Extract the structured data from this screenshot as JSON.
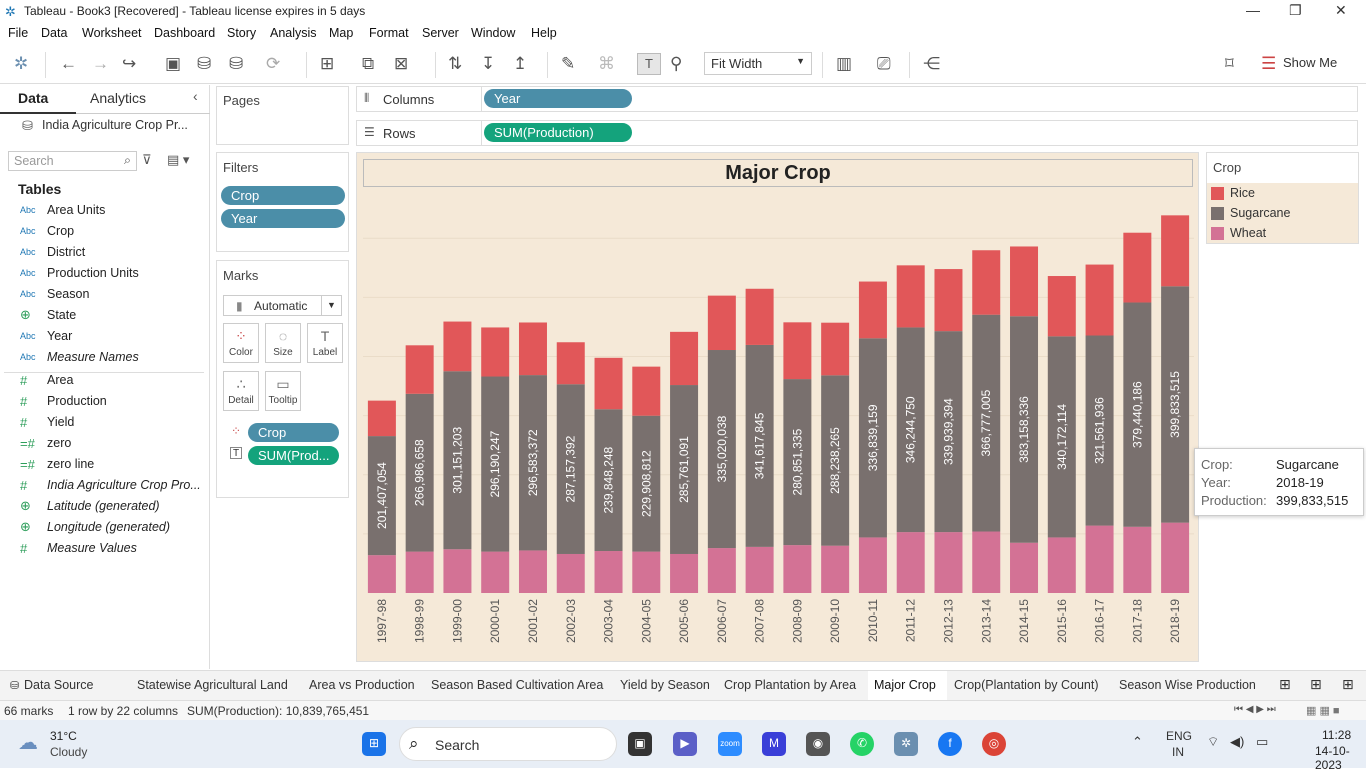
{
  "window": {
    "title": "Tableau - Book3 [Recovered] - Tableau license expires in 5 days"
  },
  "menu": [
    "File",
    "Data",
    "Worksheet",
    "Dashboard",
    "Story",
    "Analysis",
    "Map",
    "Format",
    "Server",
    "Window",
    "Help"
  ],
  "toolbar": {
    "fit": "Fit Width",
    "show_me": "Show Me"
  },
  "data_pane": {
    "tab_data": "Data",
    "tab_analytics": "Analytics",
    "datasource": "India Agriculture Crop Pr...",
    "search_placeholder": "Search",
    "tables_heading": "Tables",
    "dimensions": [
      {
        "icon": "Abc",
        "name": "Area Units"
      },
      {
        "icon": "Abc",
        "name": "Crop"
      },
      {
        "icon": "Abc",
        "name": "District"
      },
      {
        "icon": "Abc",
        "name": "Production Units"
      },
      {
        "icon": "Abc",
        "name": "Season"
      },
      {
        "icon": "globe",
        "name": "State"
      },
      {
        "icon": "Abc",
        "name": "Year"
      },
      {
        "icon": "Abc",
        "name": "Measure Names"
      }
    ],
    "measures": [
      {
        "icon": "#",
        "name": "Area"
      },
      {
        "icon": "#",
        "name": "Production"
      },
      {
        "icon": "#",
        "name": "Yield"
      },
      {
        "icon": "=#",
        "name": "zero"
      },
      {
        "icon": "=#",
        "name": "zero line"
      },
      {
        "icon": "#",
        "name": "India Agriculture Crop Pro..."
      },
      {
        "icon": "globe",
        "name": "Latitude (generated)"
      },
      {
        "icon": "globe",
        "name": "Longitude (generated)"
      },
      {
        "icon": "#",
        "name": "Measure Values"
      }
    ]
  },
  "shelves": {
    "pages": "Pages",
    "filters": "Filters",
    "filter_pills": [
      "Crop",
      "Year"
    ],
    "marks": "Marks",
    "mark_type": "Automatic",
    "mark_buttons": [
      "Color",
      "Size",
      "Label",
      "Detail",
      "Tooltip"
    ],
    "mark_pills": [
      "Crop",
      "SUM(Prod..."
    ],
    "columns_label": "Columns",
    "columns_pill": "Year",
    "rows_label": "Rows",
    "rows_pill": "SUM(Production)"
  },
  "legend": {
    "title": "Crop",
    "items": [
      {
        "name": "Rice",
        "color": "#e15759"
      },
      {
        "name": "Sugarcane",
        "color": "#79706e"
      },
      {
        "name": "Wheat",
        "color": "#d37295"
      }
    ]
  },
  "tooltip": {
    "rows": [
      {
        "k": "Crop:",
        "v": "Sugarcane"
      },
      {
        "k": "Year:",
        "v": "2018-19"
      },
      {
        "k": "Production:",
        "v": "399,833,515"
      }
    ]
  },
  "chart_data": {
    "type": "bar",
    "stacked": true,
    "title": "Major Crop",
    "categories": [
      "1997-98",
      "1998-99",
      "1999-00",
      "2000-01",
      "2001-02",
      "2002-03",
      "2003-04",
      "2004-05",
      "2005-06",
      "2006-07",
      "2007-08",
      "2008-09",
      "2009-10",
      "2010-11",
      "2011-12",
      "2012-13",
      "2013-14",
      "2014-15",
      "2015-16",
      "2016-17",
      "2017-18",
      "2018-19"
    ],
    "series": [
      {
        "name": "Wheat",
        "color": "#d37295",
        "values": [
          64000000,
          70000000,
          74000000,
          70000000,
          72000000,
          66000000,
          71000000,
          70000000,
          66000000,
          76000000,
          78000000,
          81000000,
          80000000,
          94000000,
          103000000,
          103000000,
          104000000,
          85000000,
          94000000,
          114000000,
          112000000,
          119000000
        ]
      },
      {
        "name": "Sugarcane",
        "color": "#79706e",
        "values": [
          201407054,
          266986658,
          301151203,
          296190247,
          296583372,
          287157392,
          239848248,
          229908812,
          285761091,
          335020038,
          341617845,
          280851335,
          288238265,
          336839159,
          346244750,
          339939394,
          366777005,
          383158336,
          340172114,
          321561936,
          379440186,
          399833515
        ]
      },
      {
        "name": "Rice",
        "color": "#e15759",
        "values": [
          60000000,
          82000000,
          84000000,
          83000000,
          89000000,
          71000000,
          87000000,
          83000000,
          90000000,
          92000000,
          95000000,
          96000000,
          89000000,
          96000000,
          105000000,
          105000000,
          109000000,
          118000000,
          102000000,
          120000000,
          118000000,
          120000000
        ]
      }
    ],
    "data_labels": [
      "201,407,054",
      "266,986,658",
      "301,151,203",
      "296,190,247",
      "296,583,372",
      "287,157,392",
      "239,848,248",
      "229,908,812",
      "285,761,091",
      "335,020,038",
      "341,617,845",
      "280,851,335",
      "288,238,265",
      "336,839,159",
      "346,244,750",
      "339,939,394",
      "366,777,005",
      "383,158,336",
      "340,172,114",
      "321,561,936",
      "379,440,186",
      "399,833,515"
    ],
    "ylim": [
      0,
      680000000
    ],
    "grid": false,
    "legend": "right"
  },
  "sheet_tabs": [
    "Data Source",
    "Statewise Agricultural Land",
    "Area vs Production",
    "Season Based Cultivation Area",
    "Yield by Season",
    "Crop Plantation by Area",
    "Major Crop",
    "Crop(Plantation by Count)",
    "Season Wise Production"
  ],
  "status": {
    "marks": "66 marks",
    "dims": "1 row by 22 columns",
    "sum": "SUM(Production): 10,839,765,451"
  },
  "taskbar": {
    "temp": "31°C",
    "cond": "Cloudy",
    "search": "Search",
    "lang1": "ENG",
    "lang2": "IN",
    "time": "11:28",
    "date": "14-10-2023"
  }
}
